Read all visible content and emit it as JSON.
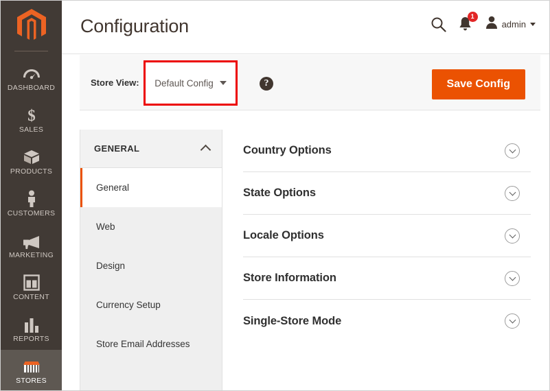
{
  "sidebar": {
    "logo_name": "magento-logo",
    "items": [
      {
        "label": "DASHBOARD",
        "icon": "gauge-icon",
        "active": false
      },
      {
        "label": "SALES",
        "icon": "dollar-icon",
        "active": false
      },
      {
        "label": "PRODUCTS",
        "icon": "box-icon",
        "active": false
      },
      {
        "label": "CUSTOMERS",
        "icon": "person-icon",
        "active": false
      },
      {
        "label": "MARKETING",
        "icon": "megaphone-icon",
        "active": false
      },
      {
        "label": "CONTENT",
        "icon": "layout-icon",
        "active": false
      },
      {
        "label": "REPORTS",
        "icon": "bar-chart-icon",
        "active": false
      },
      {
        "label": "STORES",
        "icon": "storefront-icon",
        "active": true
      }
    ]
  },
  "header": {
    "title": "Configuration",
    "search_icon": "search-icon",
    "notifications_icon": "bell-icon",
    "notifications_count": "1",
    "user_icon": "user-avatar-icon",
    "user_name": "admin"
  },
  "store_view": {
    "label": "Store View:",
    "selected": "Default Config",
    "help_icon": "question-mark-icon",
    "save_label": "Save Config"
  },
  "config_nav": {
    "section_title": "GENERAL",
    "collapse_icon": "chevron-up-icon",
    "items": [
      {
        "label": "General",
        "active": true
      },
      {
        "label": "Web",
        "active": false
      },
      {
        "label": "Design",
        "active": false
      },
      {
        "label": "Currency Setup",
        "active": false
      },
      {
        "label": "Store Email Addresses",
        "active": false
      }
    ]
  },
  "config_sections": [
    {
      "title": "Country Options",
      "toggle_icon": "chevron-down-circle-icon"
    },
    {
      "title": "State Options",
      "toggle_icon": "chevron-down-circle-icon"
    },
    {
      "title": "Locale Options",
      "toggle_icon": "chevron-down-circle-icon"
    },
    {
      "title": "Store Information",
      "toggle_icon": "chevron-down-circle-icon"
    },
    {
      "title": "Single-Store Mode",
      "toggle_icon": "chevron-down-circle-icon"
    }
  ],
  "colors": {
    "accent_orange": "#eb5202",
    "sidebar_bg": "#413a35",
    "highlight_red": "#ec0000",
    "badge_red": "#e22626"
  }
}
